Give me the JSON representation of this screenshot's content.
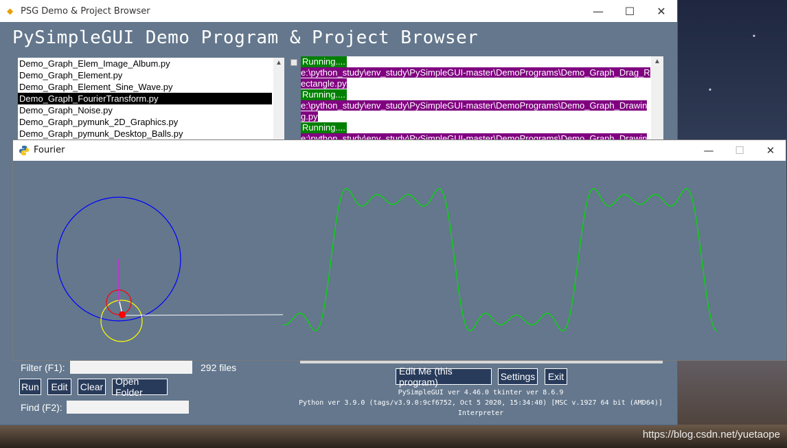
{
  "main_window": {
    "title": "PSG Demo & Project Browser",
    "heading": "PySimpleGUI Demo Program & Project Browser",
    "controls": {
      "minimize": "—",
      "maximize": "☐",
      "close": "✕"
    }
  },
  "file_list": [
    "Demo_Graph_Elem_Image_Album.py",
    "Demo_Graph_Element.py",
    "Demo_Graph_Element_Sine_Wave.py",
    "Demo_Graph_FourierTransform.py",
    "Demo_Graph_Noise.py",
    "Demo_Graph_pymunk_2D_Graphics.py",
    "Demo_Graph_pymunk_Desktop_Balls.py"
  ],
  "output": {
    "running_label": "Running....",
    "paths": [
      "e:\\python_study\\env_study\\PySimpleGUI-master\\DemoPrograms\\Demo_Graph_Drag_Rectangle.py",
      "e:\\python_study\\env_study\\PySimpleGUI-master\\DemoPrograms\\Demo_Graph_Drawing.py",
      "e:\\python_study\\env_study\\PySimpleGUI-master\\DemoPrograms\\Demo_Graph_Drawin"
    ]
  },
  "filter": {
    "label": "Filter (F1):",
    "value": "",
    "count": "292 files"
  },
  "find": {
    "label": "Find (F2):",
    "value": ""
  },
  "buttons": {
    "run": "Run",
    "edit": "Edit",
    "clear": "Clear",
    "open_folder": "Open Folder",
    "edit_me": "Edit Me (this program)",
    "settings": "Settings",
    "exit": "Exit"
  },
  "version": {
    "line1": "PySimpleGUI ver 4.46.0  tkinter ver 8.6.9",
    "line2": "Python ver 3.9.0 (tags/v3.9.0:9cf6752, Oct  5 2020, 15:34:40) [MSC v.1927 64 bit (AMD64)]",
    "line3": "Interpreter"
  },
  "fourier_window": {
    "title": "Fourier",
    "controls": {
      "minimize": "—",
      "maximize": "☐",
      "close": "✕"
    }
  },
  "colors": {
    "window_bg": "#64778d",
    "button_bg": "#283b5b",
    "running_bg": "#008000",
    "path_bg": "#800080",
    "wave": "#00dd00",
    "big_circle": "#0000ff",
    "mid_circle": "#ffff00",
    "small_circle": "#ff0000"
  },
  "watermark": "https://blog.csdn.net/yuetaope"
}
